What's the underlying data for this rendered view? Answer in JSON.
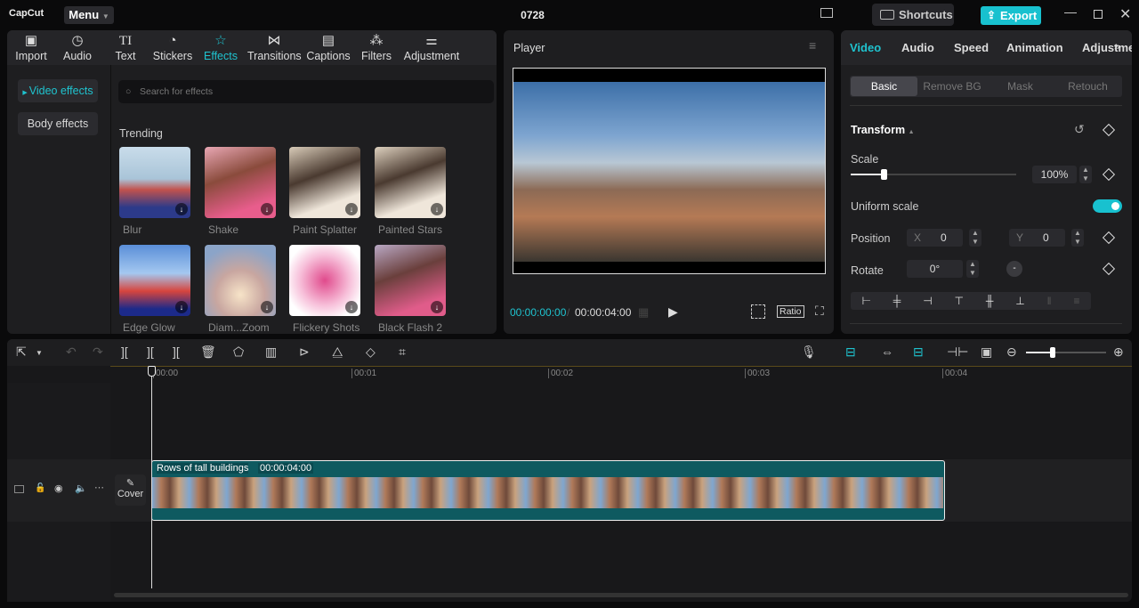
{
  "app": {
    "logo": "CapCut",
    "menu": "Menu",
    "project_title": "0728",
    "shortcuts": "Shortcuts",
    "export": "Export"
  },
  "media_tabs": [
    {
      "label": "Import",
      "icon": "import-icon"
    },
    {
      "label": "Audio",
      "icon": "audio-icon"
    },
    {
      "label": "Text",
      "icon": "text-icon"
    },
    {
      "label": "Stickers",
      "icon": "sticker-icon"
    },
    {
      "label": "Effects",
      "icon": "effects-icon",
      "active": true
    },
    {
      "label": "Transitions",
      "icon": "transitions-icon"
    },
    {
      "label": "Captions",
      "icon": "captions-icon"
    },
    {
      "label": "Filters",
      "icon": "filters-icon"
    },
    {
      "label": "Adjustment",
      "icon": "adjustment-icon"
    }
  ],
  "effects_sidebar": {
    "video_effects": "Video effects",
    "body_effects": "Body effects"
  },
  "search": {
    "placeholder": "Search for effects"
  },
  "section_title": "Trending",
  "effects": [
    {
      "label": "Blur"
    },
    {
      "label": "Shake"
    },
    {
      "label": "Paint Splatter"
    },
    {
      "label": "Painted Stars"
    },
    {
      "label": "Edge Glow"
    },
    {
      "label": "Diam...Zoom"
    },
    {
      "label": "Flickery Shots"
    },
    {
      "label": "Black Flash 2"
    }
  ],
  "player": {
    "title": "Player",
    "current_time": "00:00:00:00",
    "total_time": "00:00:04:00",
    "ratio": "Ratio"
  },
  "inspector": {
    "tabs": [
      "Video",
      "Audio",
      "Speed",
      "Animation",
      "Adjustme"
    ],
    "subtabs": [
      "Basic",
      "Remove BG",
      "Mask",
      "Retouch"
    ],
    "section": "Transform",
    "scale_label": "Scale",
    "scale_value": "100%",
    "scale_percent": 100,
    "uniform_scale": "Uniform scale",
    "uniform_scale_on": true,
    "position_label": "Position",
    "x_label": "X",
    "x_value": "0",
    "y_label": "Y",
    "y_value": "0",
    "rotate_label": "Rotate",
    "rotate_value": "0°",
    "accent": "#1fc3cf"
  },
  "timeline": {
    "ruler": [
      "00:00",
      "00:01",
      "00:02",
      "00:03",
      "00:04"
    ],
    "cover": "Cover",
    "clip_name": "Rows of tall buildings",
    "clip_duration": "00:00:04:00",
    "clip_color": "#0e5a60"
  }
}
